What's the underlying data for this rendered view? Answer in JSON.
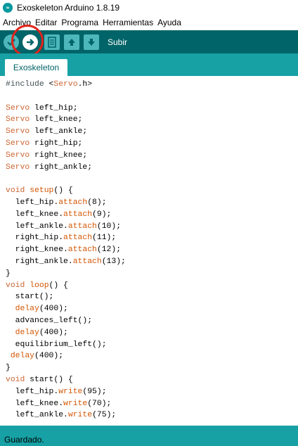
{
  "window": {
    "title": "Exoskeleton Arduino 1.8.19",
    "logo_text": "∞"
  },
  "menu": [
    "Archivo",
    "Editar",
    "Programa",
    "Herramientas",
    "Ayuda"
  ],
  "toolbar": {
    "buttons": [
      {
        "name": "verify-button",
        "icon": "check-icon",
        "glyph": "✓"
      },
      {
        "name": "upload-button",
        "icon": "arrow-right-icon",
        "glyph": "➜"
      },
      {
        "name": "new-button",
        "icon": "new-file-icon",
        "glyph": "▤"
      },
      {
        "name": "open-button",
        "icon": "arrow-up-icon",
        "glyph": "⬆"
      },
      {
        "name": "save-button",
        "icon": "arrow-down-icon",
        "glyph": "⬇"
      }
    ],
    "hover_label": "Subir",
    "highlight_color": "#e0241b"
  },
  "tab": {
    "label": "Exoskeleton"
  },
  "code": [
    [
      {
        "t": "#include ",
        "c": "pre"
      },
      {
        "t": "<",
        "c": ""
      },
      {
        "t": "Servo",
        "c": "type"
      },
      {
        "t": ".h>",
        "c": ""
      }
    ],
    [],
    [
      {
        "t": "Servo",
        "c": "type"
      },
      {
        "t": " left_hip;",
        "c": ""
      }
    ],
    [
      {
        "t": "Servo",
        "c": "type"
      },
      {
        "t": " left_knee;",
        "c": ""
      }
    ],
    [
      {
        "t": "Servo",
        "c": "type"
      },
      {
        "t": " left_ankle;",
        "c": ""
      }
    ],
    [
      {
        "t": "Servo",
        "c": "type"
      },
      {
        "t": " right_hip;",
        "c": ""
      }
    ],
    [
      {
        "t": "Servo",
        "c": "type"
      },
      {
        "t": " right_knee;",
        "c": ""
      }
    ],
    [
      {
        "t": "Servo",
        "c": "type"
      },
      {
        "t": " right_ankle;",
        "c": ""
      }
    ],
    [],
    [
      {
        "t": "void",
        "c": "type"
      },
      {
        "t": " ",
        "c": ""
      },
      {
        "t": "setup",
        "c": "func"
      },
      {
        "t": "() {",
        "c": ""
      }
    ],
    [
      {
        "t": "  left_hip.",
        "c": ""
      },
      {
        "t": "attach",
        "c": "func"
      },
      {
        "t": "(8);",
        "c": ""
      }
    ],
    [
      {
        "t": "  left_knee.",
        "c": ""
      },
      {
        "t": "attach",
        "c": "func"
      },
      {
        "t": "(9);",
        "c": ""
      }
    ],
    [
      {
        "t": "  left_ankle.",
        "c": ""
      },
      {
        "t": "attach",
        "c": "func"
      },
      {
        "t": "(10);",
        "c": ""
      }
    ],
    [
      {
        "t": "  right_hip.",
        "c": ""
      },
      {
        "t": "attach",
        "c": "func"
      },
      {
        "t": "(11);",
        "c": ""
      }
    ],
    [
      {
        "t": "  right_knee.",
        "c": ""
      },
      {
        "t": "attach",
        "c": "func"
      },
      {
        "t": "(12);",
        "c": ""
      }
    ],
    [
      {
        "t": "  right_ankle.",
        "c": ""
      },
      {
        "t": "attach",
        "c": "func"
      },
      {
        "t": "(13);",
        "c": ""
      }
    ],
    [
      {
        "t": "}",
        "c": ""
      }
    ],
    [
      {
        "t": "void",
        "c": "type"
      },
      {
        "t": " ",
        "c": ""
      },
      {
        "t": "loop",
        "c": "func"
      },
      {
        "t": "() {",
        "c": ""
      }
    ],
    [
      {
        "t": "  start();",
        "c": ""
      }
    ],
    [
      {
        "t": "  ",
        "c": ""
      },
      {
        "t": "delay",
        "c": "func"
      },
      {
        "t": "(400);",
        "c": ""
      }
    ],
    [
      {
        "t": "  advances_left();",
        "c": ""
      }
    ],
    [
      {
        "t": "  ",
        "c": ""
      },
      {
        "t": "delay",
        "c": "func"
      },
      {
        "t": "(400);",
        "c": ""
      }
    ],
    [
      {
        "t": "  equilibrium_left();",
        "c": ""
      }
    ],
    [
      {
        "t": " ",
        "c": ""
      },
      {
        "t": "delay",
        "c": "func"
      },
      {
        "t": "(400);",
        "c": ""
      }
    ],
    [
      {
        "t": "}",
        "c": ""
      }
    ],
    [
      {
        "t": "void",
        "c": "type"
      },
      {
        "t": " start() {",
        "c": ""
      }
    ],
    [
      {
        "t": "  left_hip.",
        "c": ""
      },
      {
        "t": "write",
        "c": "func"
      },
      {
        "t": "(95);",
        "c": ""
      }
    ],
    [
      {
        "t": "  left_knee.",
        "c": ""
      },
      {
        "t": "write",
        "c": "func"
      },
      {
        "t": "(70);",
        "c": ""
      }
    ],
    [
      {
        "t": "  left_ankle.",
        "c": ""
      },
      {
        "t": "write",
        "c": "func"
      },
      {
        "t": "(75);",
        "c": ""
      }
    ]
  ],
  "status": {
    "text": "Guardado."
  },
  "colors": {
    "toolbar": "#006468",
    "tabbar": "#17a1a5",
    "button": "#4db7bb",
    "keyword_type": "#cc6633",
    "keyword_func": "#d35400"
  }
}
